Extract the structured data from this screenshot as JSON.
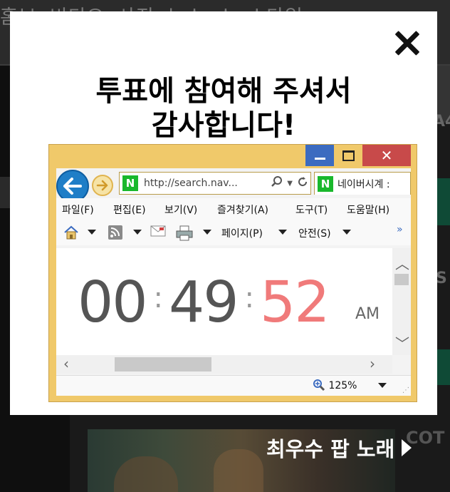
{
  "background": {
    "nav": [
      "홈보",
      "비디오",
      "사진",
      "뉴스",
      "스",
      "스타일"
    ],
    "right_text_1": "A4",
    "right_text_2": "S",
    "right_text_3": "COT",
    "best_song": "최우수 팝 노래"
  },
  "modal": {
    "title_line1": "투표에 참여해 주셔서",
    "title_line2": "감사합니다!",
    "close_icon": "close-icon"
  },
  "ie": {
    "window_close_symbol": "✕",
    "address": "http://search.nav...",
    "tab_title": "네이버시계 :",
    "menu": [
      "파일(F)",
      "편집(E)",
      "보기(V)",
      "즐겨찾기(A)",
      "도구(T)",
      "도움말(H)"
    ],
    "command": {
      "page": "페이지(P)",
      "safety": "안전(S)",
      "more": "»"
    },
    "clock": {
      "hours": "00",
      "minutes": "49",
      "seconds": "52",
      "ampm": "AM"
    },
    "zoom": "125%",
    "accent_blue": "#1f7ec7",
    "frame_color": "#f0c96a"
  }
}
